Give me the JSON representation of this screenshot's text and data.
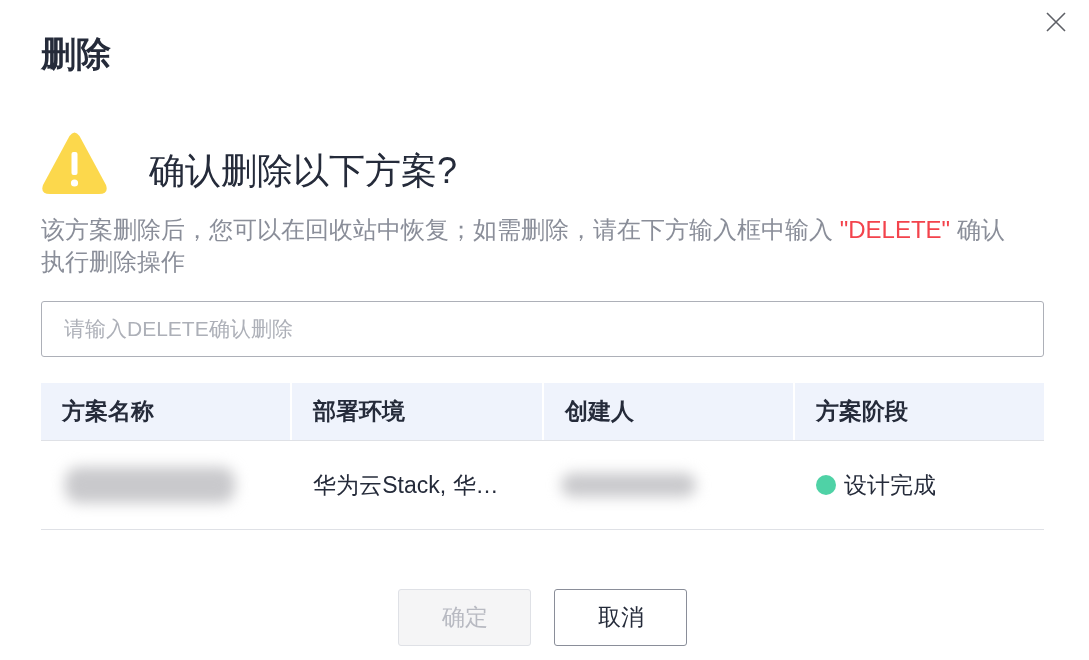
{
  "dialog": {
    "title": "删除"
  },
  "warning": {
    "heading": "确认删除以下方案?",
    "description": [
      {
        "kind": "plain",
        "text": "该方案删除后，您可以在回收站中恢复；如需删除，请在下方输入框中输入 "
      },
      {
        "kind": "highlight",
        "text": "\"DELETE\""
      },
      {
        "kind": "plain",
        "text": " 确认执行删除操作"
      }
    ]
  },
  "input": {
    "placeholder": "请输入DELETE确认删除"
  },
  "table": {
    "columns": [
      "方案名称",
      "部署环境",
      "创建人",
      "方案阶段"
    ],
    "rows": [
      {
        "cells": [
          {
            "kind": "blurred"
          },
          {
            "kind": "text",
            "text": "华为云Stack, 华…"
          },
          {
            "kind": "blurred"
          },
          {
            "kind": "status",
            "text": "设计完成",
            "color": "#4fd2a6"
          }
        ]
      }
    ]
  },
  "buttons": [
    {
      "kind": "primary",
      "label": "确定",
      "disabled": true
    },
    {
      "kind": "default",
      "label": "取消",
      "disabled": false
    }
  ]
}
